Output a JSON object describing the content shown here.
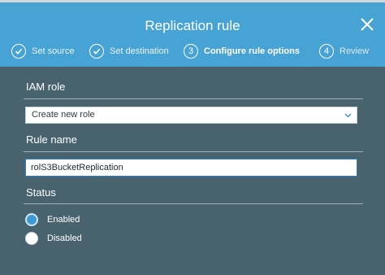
{
  "dialog": {
    "title": "Replication rule"
  },
  "steps": [
    {
      "number": "1",
      "label": "Set source",
      "state": "completed"
    },
    {
      "number": "2",
      "label": "Set destination",
      "state": "completed"
    },
    {
      "number": "3",
      "label": "Configure rule options",
      "state": "active"
    },
    {
      "number": "4",
      "label": "Review",
      "state": "pending"
    }
  ],
  "form": {
    "iam_role": {
      "label": "IAM role",
      "selected": "Create new role"
    },
    "rule_name": {
      "label": "Rule name",
      "value": "rolS3BucketReplication"
    },
    "status": {
      "label": "Status",
      "options": [
        {
          "label": "Enabled",
          "checked": true
        },
        {
          "label": "Disabled",
          "checked": false
        }
      ]
    }
  },
  "icons": {
    "close": "close-icon",
    "check": "check-icon",
    "chevron": "chevron-down-icon"
  },
  "colors": {
    "header": "#47a3d4",
    "body": "#48626e",
    "accent": "#3d9ad3"
  }
}
